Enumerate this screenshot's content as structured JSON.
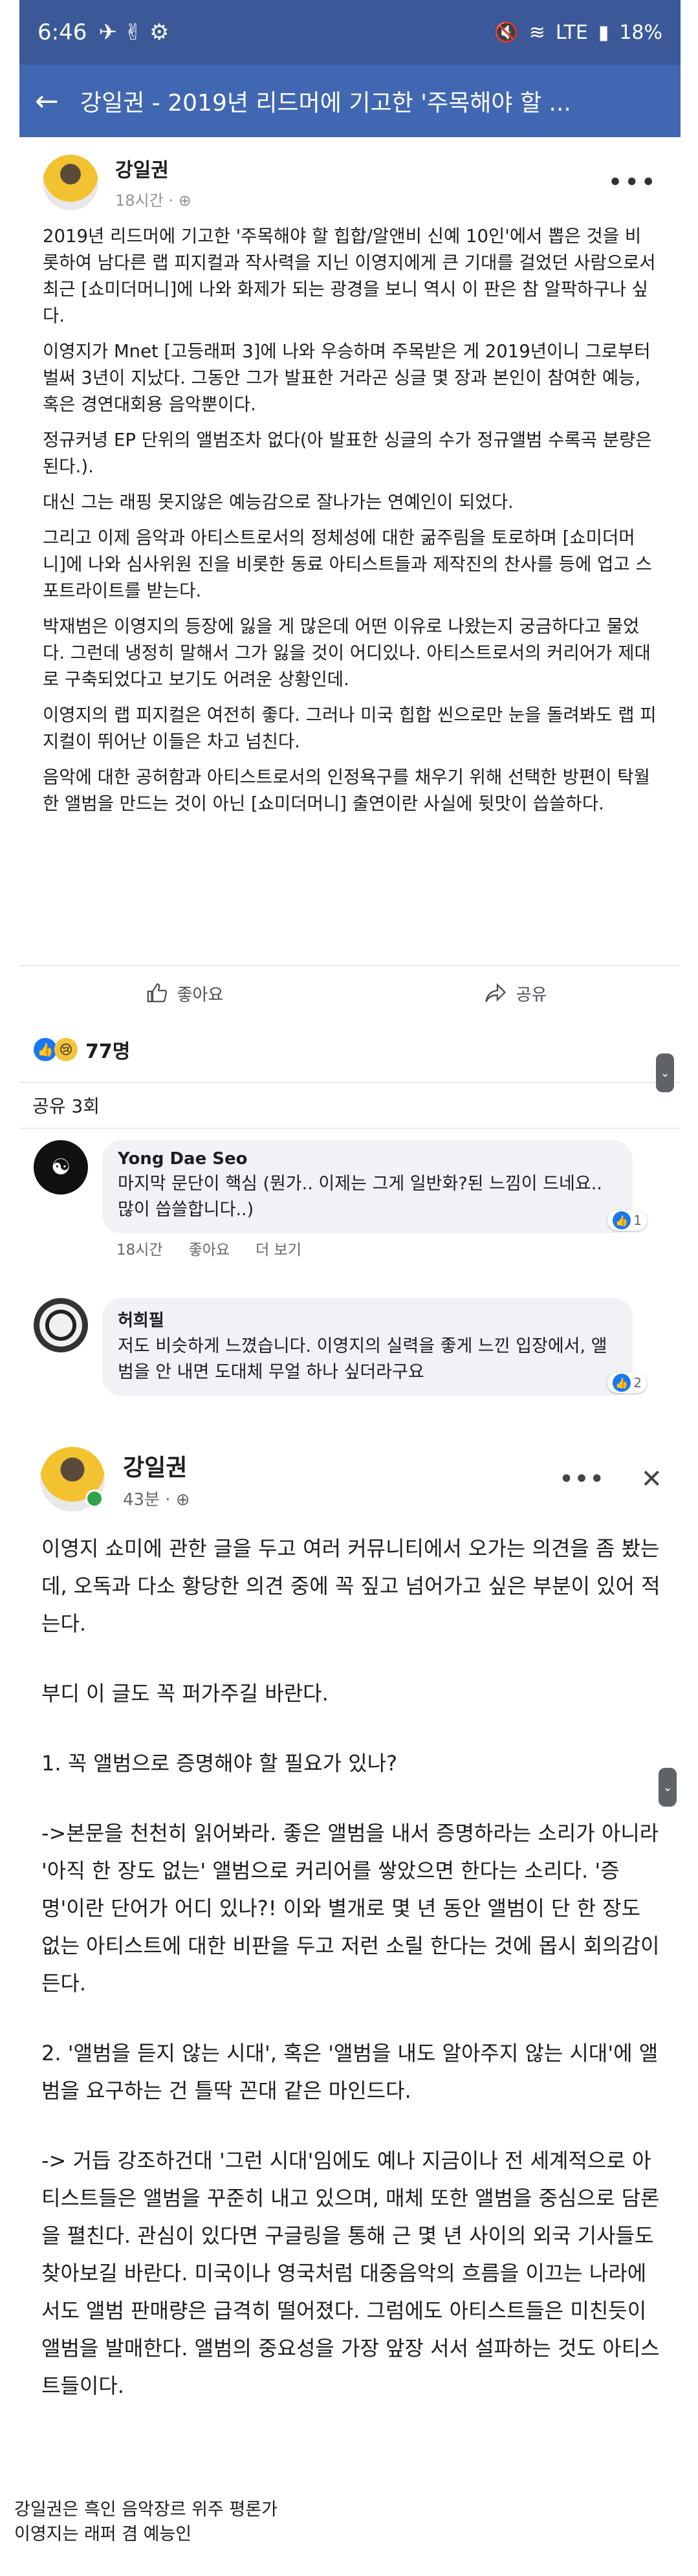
{
  "status_bar": {
    "time": "6:46",
    "battery": "18%",
    "network": "LTE"
  },
  "app_bar": {
    "title": "강일권 - 2019년 리드머에 기고한 '주목해야 할 ..."
  },
  "post": {
    "author": "강일권",
    "time": "18시간",
    "paragraphs": [
      "2019년 리드머에 기고한 '주목해야 할 힙합/알앤비 신예 10인'에서 뽑은 것을 비롯하여 남다른 랩 피지컬과 작사력을 지닌 이영지에게 큰 기대를 걸었던 사람으로서 최근 [쇼미더머니]에 나와 화제가 되는 광경을 보니 역시 이 판은 참 알팍하구나 싶다.",
      "이영지가 Mnet [고등래퍼 3]에 나와 우승하며 주목받은 게 2019년이니 그로부터 벌써 3년이 지났다. 그동안 그가 발표한 거라곤 싱글 몇 장과 본인이 참여한 예능, 혹은 경연대회용 음악뿐이다.",
      "정규커녕 EP 단위의 앨범조차 없다(아 발표한 싱글의 수가 정규앨범 수록곡 분량은 된다.).",
      "대신 그는 래핑 못지않은 예능감으로 잘나가는 연예인이 되었다.",
      "그리고 이제 음악과 아티스트로서의 정체성에 대한 굶주림을 토로하며 [쇼미더머니]에 나와 심사위원 진을 비롯한 동료 아티스트들과 제작진의 찬사를 등에 업고 스포트라이트를 받는다.",
      "박재범은 이영지의 등장에 잃을 게 많은데 어떤 이유로 나왔는지 궁금하다고 물었다. 그런데 냉정히 말해서 그가 잃을 것이 어디있나. 아티스트로서의 커리어가 제대로 구축되었다고 보기도 어려운 상황인데.",
      "이영지의 랩 피지컬은 여전히 좋다. 그러나 미국 힙합 씬으로만 눈을 돌려봐도 랩 피지컬이 뛰어난 이들은 차고 넘친다.",
      "음악에 대한 공허함과 아티스트로서의 인정욕구를 채우기 위해 선택한 방편이 탁월한 앨범을 만드는 것이 아닌 [쇼미더머니] 출연이란 사실에 뒷맛이 씁쓸하다."
    ],
    "like_label": "좋아요",
    "share_label": "공유",
    "reaction_count": "77명",
    "share_count": "공유 3회"
  },
  "comments": [
    {
      "name": "Yong Dae Seo",
      "text": "마지막 문단이 핵심 (뭔가.. 이제는 그게 일반화?된 느낌이 드네요.. 많이 씁쓸합니다..)",
      "reactions": "1",
      "time": "18시간",
      "like_label": "좋아요",
      "more_label": "더 보기"
    },
    {
      "name": "허희필",
      "text": "저도 비슷하게 느꼈습니다. 이영지의 실력을 좋게 느낀 입장에서, 앨범을 안 내면 도대체 무얼 하나 싶더라구요",
      "reactions": "2"
    }
  ],
  "post2": {
    "author": "강일권",
    "time": "43분",
    "paragraphs": [
      "이영지 쇼미에 관한 글을 두고 여러 커뮤니티에서 오가는 의견을 좀 봤는데, 오독과 다소 황당한 의견 중에 꼭 짚고 넘어가고 싶은 부분이 있어 적는다.",
      "부디 이 글도 꼭 퍼가주길 바란다.",
      "1. 꼭 앨범으로 증명해야 할 필요가 있나?",
      "->본문을 천천히 읽어봐라. 좋은 앨범을 내서 증명하라는 소리가 아니라 '아직 한 장도 없는' 앨범으로 커리어를 쌓았으면 한다는 소리다. '증명'이란 단어가 어디 있나?! 이와 별개로 몇 년 동안 앨범이 단 한 장도 없는 아티스트에 대한 비판을 두고 저런 소릴 한다는 것에 몹시 회의감이 든다.",
      "2. '앨범을 듣지 않는 시대', 혹은 '앨범을 내도 알아주지 않는 시대'에 앨범을 요구하는 건 틀딱 꼰대 같은 마인드다.",
      "-> 거듭 강조하건대 '그런 시대'임에도 예나 지금이나 전 세계적으로 아티스트들은 앨범을 꾸준히 내고 있으며, 매체 또한 앨범을 중심으로 담론을 펼친다. 관심이 있다면 구글링을 통해 근 몇 년 사이의 외국 기사들도 찾아보길 바란다. 미국이나 영국처럼 대중음악의 흐름을 이끄는 나라에서도 앨범 판매량은 급격히 떨어졌다. 그럼에도 아티스트들은 미친듯이 앨범을 발매한다. 앨범의 중요성을 가장 앞장 서서 설파하는 것도 아티스트들이다."
    ]
  },
  "caption": {
    "line1": "강일권은 흑인 음악장르 위주 평론가",
    "line2": "이영지는 래퍼 겸 예능인"
  },
  "colors": {
    "status_bar": "#3b5998",
    "app_bar": "#4267b2",
    "like_blue": "#1877f2"
  }
}
